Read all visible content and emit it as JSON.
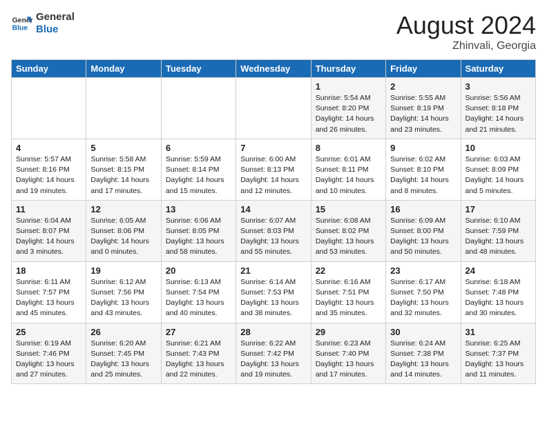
{
  "logo": {
    "line1": "General",
    "line2": "Blue"
  },
  "title": "August 2024",
  "location": "Zhinvali, Georgia",
  "days_of_week": [
    "Sunday",
    "Monday",
    "Tuesday",
    "Wednesday",
    "Thursday",
    "Friday",
    "Saturday"
  ],
  "weeks": [
    [
      {
        "num": "",
        "info": ""
      },
      {
        "num": "",
        "info": ""
      },
      {
        "num": "",
        "info": ""
      },
      {
        "num": "",
        "info": ""
      },
      {
        "num": "1",
        "info": "Sunrise: 5:54 AM\nSunset: 8:20 PM\nDaylight: 14 hours\nand 26 minutes."
      },
      {
        "num": "2",
        "info": "Sunrise: 5:55 AM\nSunset: 8:19 PM\nDaylight: 14 hours\nand 23 minutes."
      },
      {
        "num": "3",
        "info": "Sunrise: 5:56 AM\nSunset: 8:18 PM\nDaylight: 14 hours\nand 21 minutes."
      }
    ],
    [
      {
        "num": "4",
        "info": "Sunrise: 5:57 AM\nSunset: 8:16 PM\nDaylight: 14 hours\nand 19 minutes."
      },
      {
        "num": "5",
        "info": "Sunrise: 5:58 AM\nSunset: 8:15 PM\nDaylight: 14 hours\nand 17 minutes."
      },
      {
        "num": "6",
        "info": "Sunrise: 5:59 AM\nSunset: 8:14 PM\nDaylight: 14 hours\nand 15 minutes."
      },
      {
        "num": "7",
        "info": "Sunrise: 6:00 AM\nSunset: 8:13 PM\nDaylight: 14 hours\nand 12 minutes."
      },
      {
        "num": "8",
        "info": "Sunrise: 6:01 AM\nSunset: 8:11 PM\nDaylight: 14 hours\nand 10 minutes."
      },
      {
        "num": "9",
        "info": "Sunrise: 6:02 AM\nSunset: 8:10 PM\nDaylight: 14 hours\nand 8 minutes."
      },
      {
        "num": "10",
        "info": "Sunrise: 6:03 AM\nSunset: 8:09 PM\nDaylight: 14 hours\nand 5 minutes."
      }
    ],
    [
      {
        "num": "11",
        "info": "Sunrise: 6:04 AM\nSunset: 8:07 PM\nDaylight: 14 hours\nand 3 minutes."
      },
      {
        "num": "12",
        "info": "Sunrise: 6:05 AM\nSunset: 8:06 PM\nDaylight: 14 hours\nand 0 minutes."
      },
      {
        "num": "13",
        "info": "Sunrise: 6:06 AM\nSunset: 8:05 PM\nDaylight: 13 hours\nand 58 minutes."
      },
      {
        "num": "14",
        "info": "Sunrise: 6:07 AM\nSunset: 8:03 PM\nDaylight: 13 hours\nand 55 minutes."
      },
      {
        "num": "15",
        "info": "Sunrise: 6:08 AM\nSunset: 8:02 PM\nDaylight: 13 hours\nand 53 minutes."
      },
      {
        "num": "16",
        "info": "Sunrise: 6:09 AM\nSunset: 8:00 PM\nDaylight: 13 hours\nand 50 minutes."
      },
      {
        "num": "17",
        "info": "Sunrise: 6:10 AM\nSunset: 7:59 PM\nDaylight: 13 hours\nand 48 minutes."
      }
    ],
    [
      {
        "num": "18",
        "info": "Sunrise: 6:11 AM\nSunset: 7:57 PM\nDaylight: 13 hours\nand 45 minutes."
      },
      {
        "num": "19",
        "info": "Sunrise: 6:12 AM\nSunset: 7:56 PM\nDaylight: 13 hours\nand 43 minutes."
      },
      {
        "num": "20",
        "info": "Sunrise: 6:13 AM\nSunset: 7:54 PM\nDaylight: 13 hours\nand 40 minutes."
      },
      {
        "num": "21",
        "info": "Sunrise: 6:14 AM\nSunset: 7:53 PM\nDaylight: 13 hours\nand 38 minutes."
      },
      {
        "num": "22",
        "info": "Sunrise: 6:16 AM\nSunset: 7:51 PM\nDaylight: 13 hours\nand 35 minutes."
      },
      {
        "num": "23",
        "info": "Sunrise: 6:17 AM\nSunset: 7:50 PM\nDaylight: 13 hours\nand 32 minutes."
      },
      {
        "num": "24",
        "info": "Sunrise: 6:18 AM\nSunset: 7:48 PM\nDaylight: 13 hours\nand 30 minutes."
      }
    ],
    [
      {
        "num": "25",
        "info": "Sunrise: 6:19 AM\nSunset: 7:46 PM\nDaylight: 13 hours\nand 27 minutes."
      },
      {
        "num": "26",
        "info": "Sunrise: 6:20 AM\nSunset: 7:45 PM\nDaylight: 13 hours\nand 25 minutes."
      },
      {
        "num": "27",
        "info": "Sunrise: 6:21 AM\nSunset: 7:43 PM\nDaylight: 13 hours\nand 22 minutes."
      },
      {
        "num": "28",
        "info": "Sunrise: 6:22 AM\nSunset: 7:42 PM\nDaylight: 13 hours\nand 19 minutes."
      },
      {
        "num": "29",
        "info": "Sunrise: 6:23 AM\nSunset: 7:40 PM\nDaylight: 13 hours\nand 17 minutes."
      },
      {
        "num": "30",
        "info": "Sunrise: 6:24 AM\nSunset: 7:38 PM\nDaylight: 13 hours\nand 14 minutes."
      },
      {
        "num": "31",
        "info": "Sunrise: 6:25 AM\nSunset: 7:37 PM\nDaylight: 13 hours\nand 11 minutes."
      }
    ]
  ]
}
